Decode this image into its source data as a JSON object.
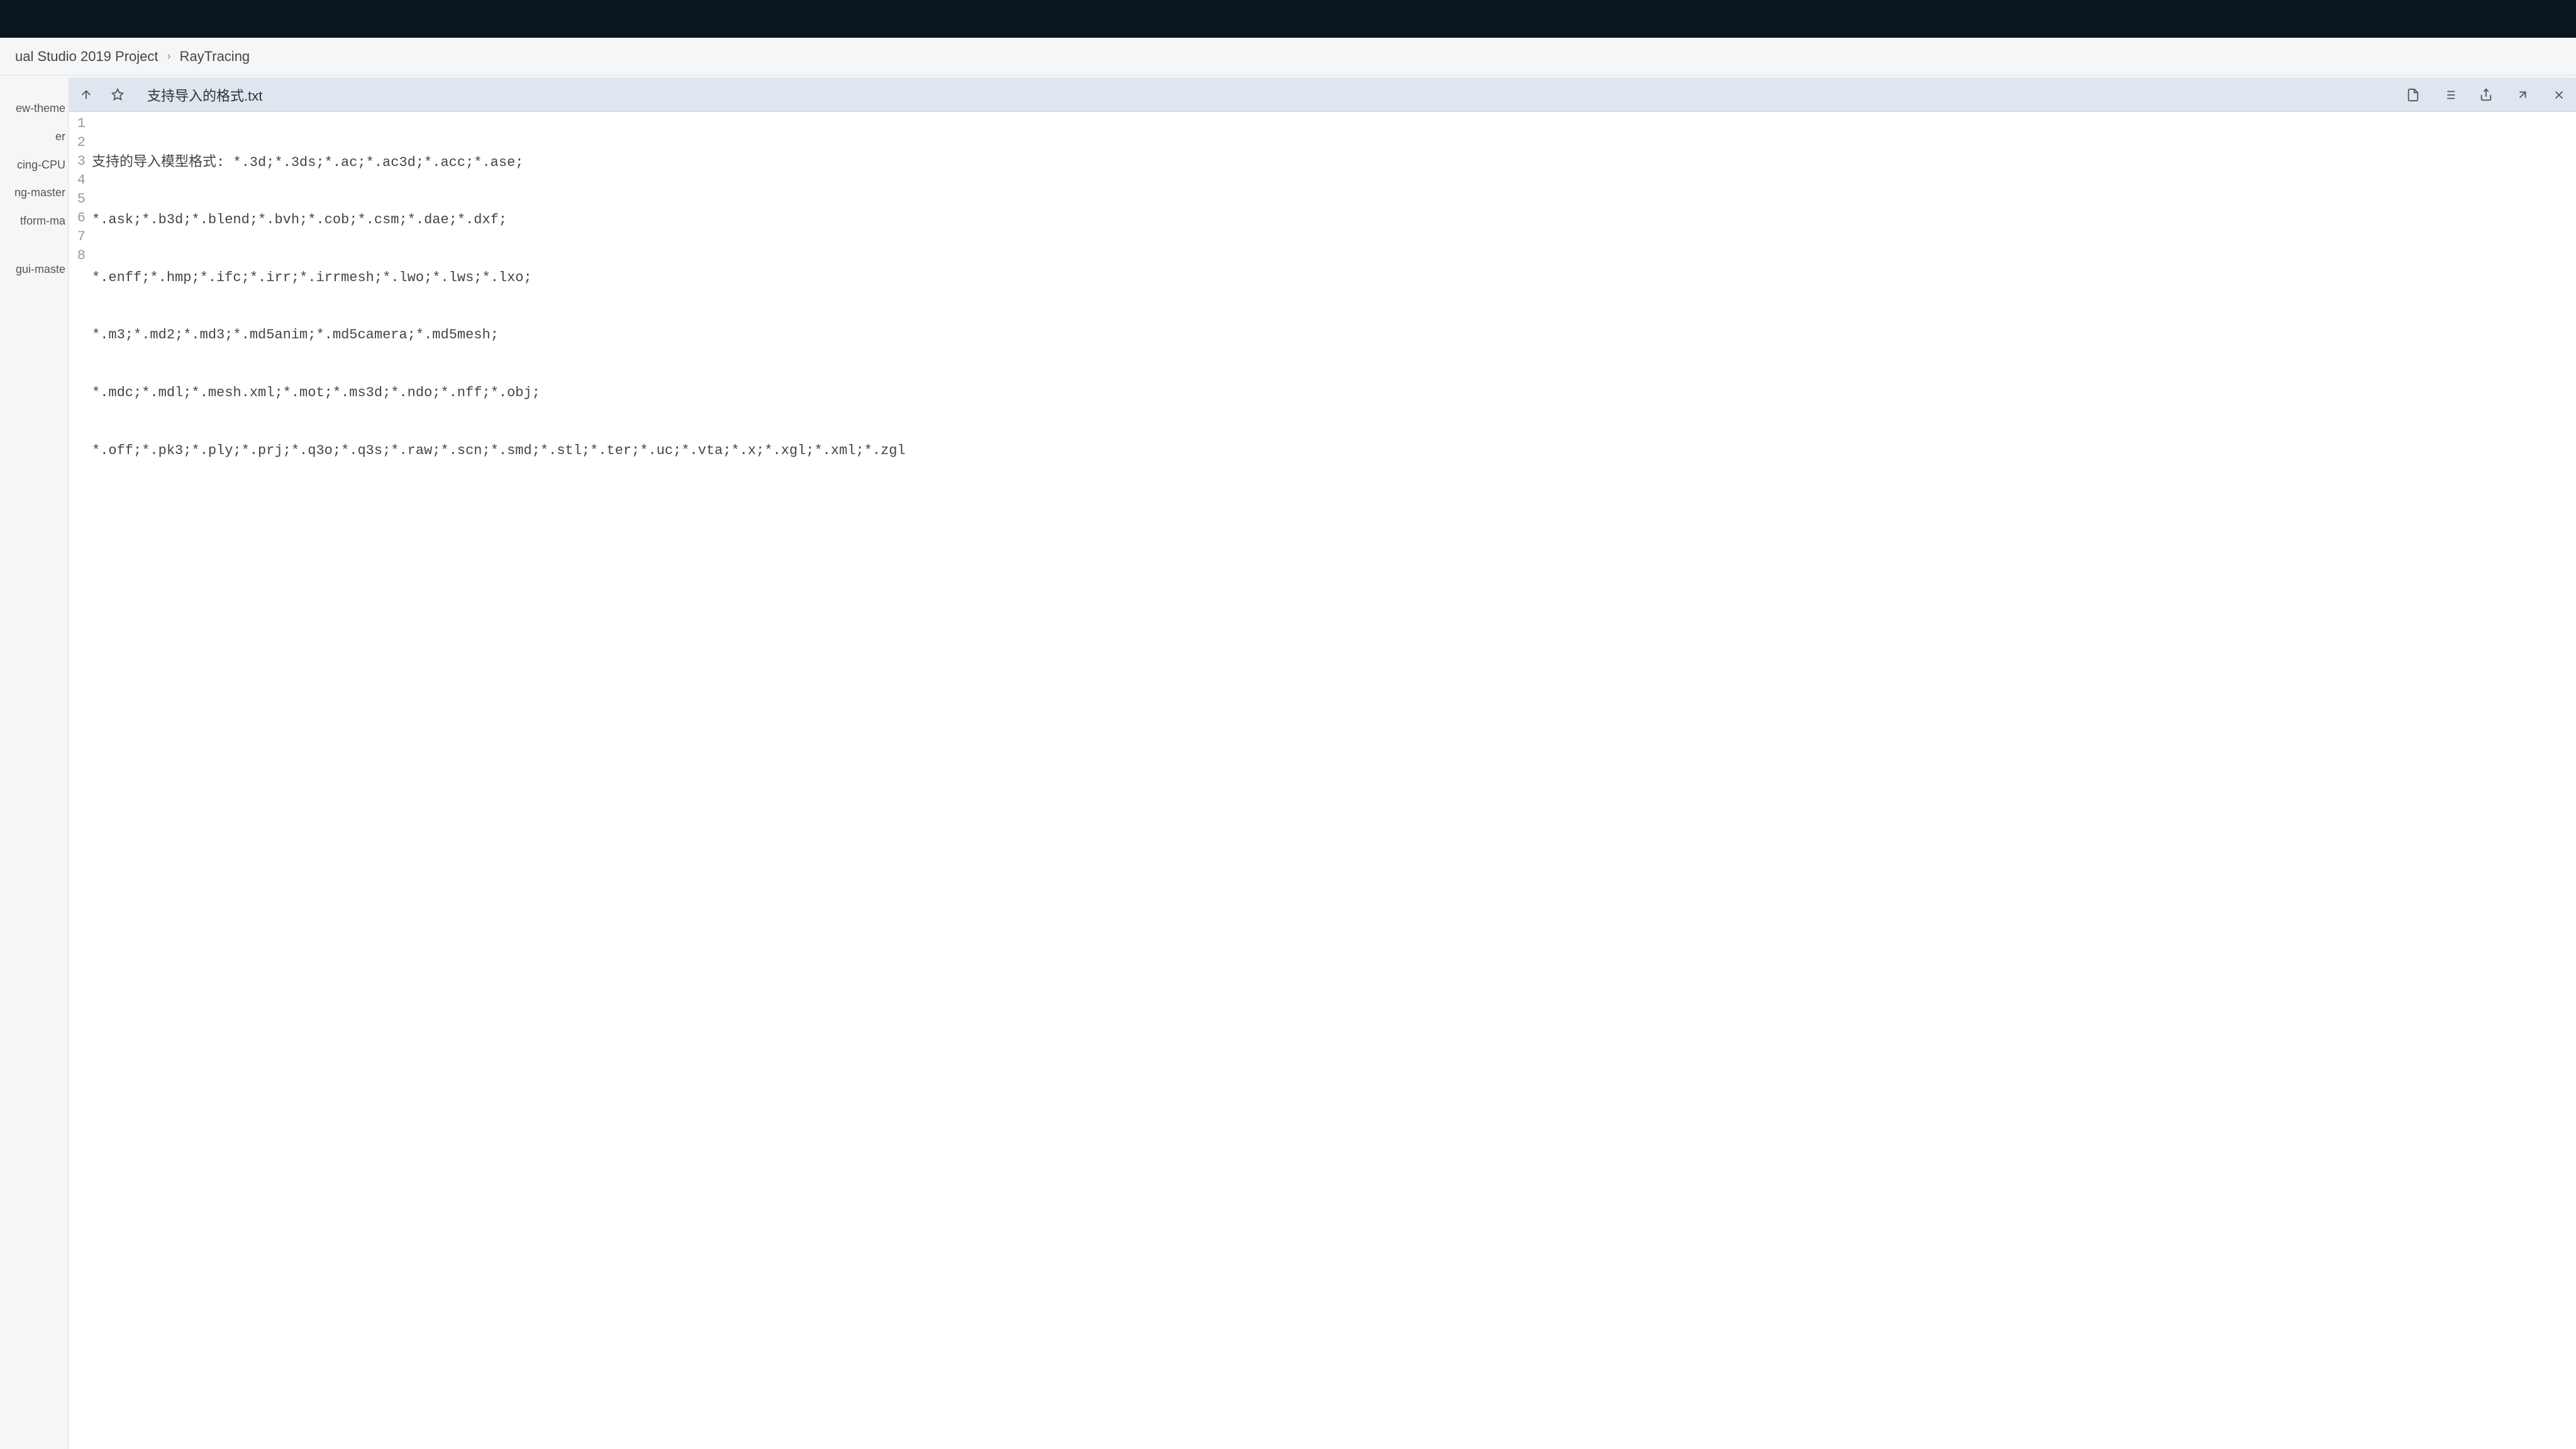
{
  "breadcrumb": {
    "segment1": "ual Studio 2019 Project",
    "segment2": "RayTracing"
  },
  "sidebar": {
    "items": [
      "ew-theme",
      "er",
      "cing-CPU",
      "ng-master",
      "tform-ma",
      "",
      "",
      "gui-maste"
    ]
  },
  "preview": {
    "filename": "支持导入的格式.txt",
    "lines": [
      "支持的导入模型格式: *.3d;*.3ds;*.ac;*.ac3d;*.acc;*.ase;",
      "*.ask;*.b3d;*.blend;*.bvh;*.cob;*.csm;*.dae;*.dxf;",
      "*.enff;*.hmp;*.ifc;*.irr;*.irrmesh;*.lwo;*.lws;*.lxo;",
      "*.m3;*.md2;*.md3;*.md5anim;*.md5camera;*.md5mesh;",
      "*.mdc;*.mdl;*.mesh.xml;*.mot;*.ms3d;*.ndo;*.nff;*.obj;",
      "*.off;*.pk3;*.ply;*.prj;*.q3o;*.q3s;*.raw;*.scn;*.smd;*.stl;*.ter;*.uc;*.vta;*.x;*.xgl;*.xml;*.zgl",
      "",
      ""
    ],
    "line_numbers": [
      "1",
      "2",
      "3",
      "4",
      "5",
      "6",
      "7",
      "8"
    ]
  }
}
